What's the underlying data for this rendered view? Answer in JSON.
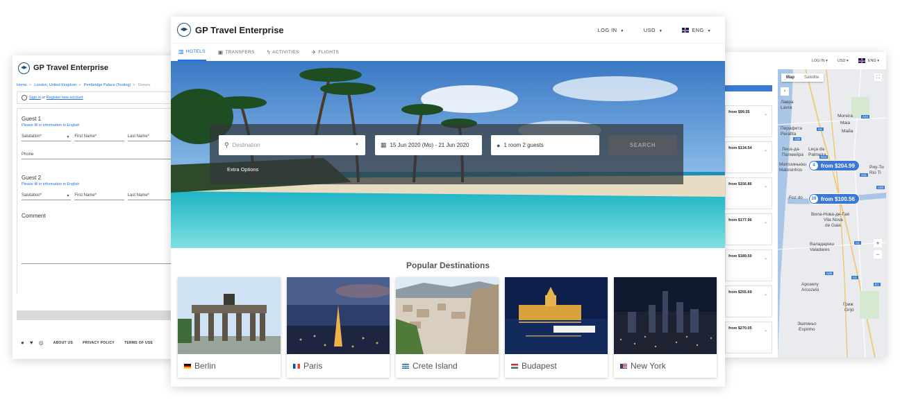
{
  "left_window": {
    "brand": "GP Travel Enterprise",
    "breadcrumb": [
      "Home",
      "London, United Kingdom",
      "Pembridge Palace (Testing)",
      "Reserv"
    ],
    "signin": {
      "sign_in": "Sign in",
      "or": "or",
      "register": "Register new account"
    },
    "guests": [
      {
        "title": "Guest 1",
        "subtitle": "Please fill in information in English",
        "fields": [
          "Salutation*",
          "First Name*",
          "Last Name*"
        ],
        "phone": "Phone"
      },
      {
        "title": "Guest 2",
        "subtitle": "Please fill in information in English",
        "fields": [
          "Salutation*",
          "First Name*",
          "Last Name*"
        ]
      }
    ],
    "comment": "Comment",
    "footer_links": [
      "ABOUT US",
      "PRIVACY POLICY",
      "TERMS OF USE"
    ]
  },
  "main_window": {
    "brand": "GP Travel Enterprise",
    "header": {
      "login": "LOG IN",
      "currency": "USD",
      "language": "ENG"
    },
    "tabs": [
      {
        "label": "HOTELS",
        "icon": "hotel-icon",
        "active": true
      },
      {
        "label": "TRANSFERS",
        "icon": "bus-icon",
        "active": false
      },
      {
        "label": "ACTIVITIES",
        "icon": "bolt-icon",
        "active": false
      },
      {
        "label": "FLIGHTS",
        "icon": "plane-icon",
        "active": false
      }
    ],
    "search": {
      "destination_placeholder": "Destination",
      "dates": "15 Jun 2020 (Mo) -  21 Jun 2020",
      "guests": "1 room 2 guests",
      "button": "SEARCH",
      "extra_options": "Extra Options"
    },
    "popular_title": "Popular Destinations",
    "destinations": [
      {
        "name": "Berlin",
        "flag": "de"
      },
      {
        "name": "Paris",
        "flag": "fr"
      },
      {
        "name": "Crete Island",
        "flag": "gr"
      },
      {
        "name": "Budapest",
        "flag": "hu"
      },
      {
        "name": "New York",
        "flag": "us"
      }
    ]
  },
  "right_window": {
    "header": {
      "login": "LOG IN",
      "currency": "USD",
      "language": "ENG"
    },
    "prices": [
      "from $99.55",
      "from $134.54",
      "from $156.86",
      "from $177.96",
      "from $189.50",
      "from $255.69",
      "from $270.05"
    ],
    "map_tabs": {
      "map": "Map",
      "satellite": "Satellite"
    },
    "pins": [
      {
        "count": "4",
        "label": "from $204.99"
      },
      {
        "count": "28",
        "label": "from $100.56"
      }
    ],
    "map_labels": [
      "Лавра",
      "Lavra",
      "Moreira",
      "Maia",
      "Перафита",
      "Perafita",
      "Майа",
      "Леса-да-",
      "Палмейра",
      "Leça da",
      "Palmeira",
      "Матозиньюш",
      "Matosinhos",
      "Риу-Ти",
      "Rio Ti",
      "Foz do",
      "Вила-Нова-де-Гая",
      "Vila Nova",
      "de Gaia",
      "Валадареш",
      "Valadares",
      "Арозелу",
      "Arcozelo",
      "Гриж",
      "Grijó",
      "Эшпиньо",
      "Espinho"
    ],
    "roads": [
      "A41",
      "A4",
      "A28",
      "N13",
      "A41",
      "A20",
      "A1",
      "A29",
      "A1",
      "E1"
    ]
  }
}
